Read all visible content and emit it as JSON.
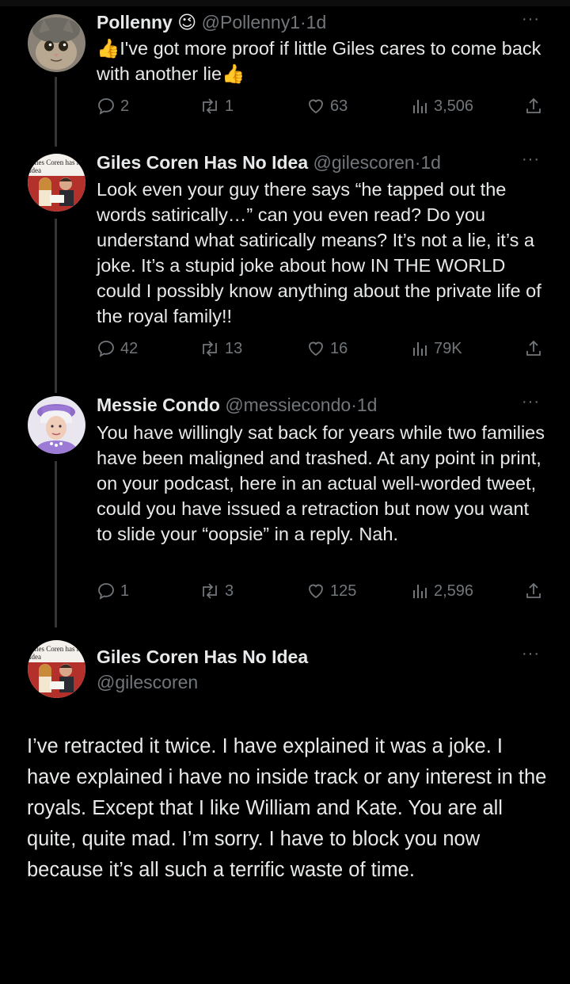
{
  "tweets": [
    {
      "name": "Pollenny",
      "name_emoji": "😉",
      "handle": "@Pollenny1",
      "time": "1d",
      "text": "👍I've got more proof if little Giles cares to come back with another lie👍",
      "replies": "2",
      "retweets": "1",
      "likes": "63",
      "views": "3,506"
    },
    {
      "name": "Giles Coren Has No Idea",
      "handle": "@gilescoren",
      "time": "1d",
      "avatar_caption": "Giles Coren has no idea",
      "text": "Look even your guy there says “he tapped out the words satirically…” can you even read? Do you understand what satirically means? It’s not a lie, it’s a joke. It’s a stupid joke about how IN THE WORLD could I possibly know anything about the private life of the royal family!!",
      "replies": "42",
      "retweets": "13",
      "likes": "16",
      "views": "79K"
    },
    {
      "name": "Messie Condo",
      "handle": "@messiecondo",
      "time": "1d",
      "text": "You have willingly sat back for years while two families have been maligned and trashed. At any point in print, on your podcast, here in an actual well-worded tweet, could you have issued a retraction but now you want to slide your “oopsie” in a reply. Nah.",
      "replies": "1",
      "retweets": "3",
      "likes": "125",
      "views": "2,596"
    }
  ],
  "main_tweet": {
    "name": "Giles Coren Has No Idea",
    "handle": "@gilescoren",
    "avatar_caption": "Giles Coren has no idea",
    "text": "I’ve retracted it twice. I have explained it was a joke. I have explained i have no inside track or any interest in the royals. Except that I like William and Kate. You are all quite, quite mad. I’m sorry. I have to block you now because it’s all such a terrific waste of time."
  },
  "ui": {
    "separator": "·",
    "more": "···"
  },
  "icons": {
    "reply": "reply-icon",
    "retweet": "retweet-icon",
    "like": "heart-icon",
    "views": "views-icon",
    "share": "share-icon"
  },
  "colors": {
    "background": "#000000",
    "text": "#e7e9ea",
    "secondary": "#71767b",
    "thread_line": "#333639"
  }
}
